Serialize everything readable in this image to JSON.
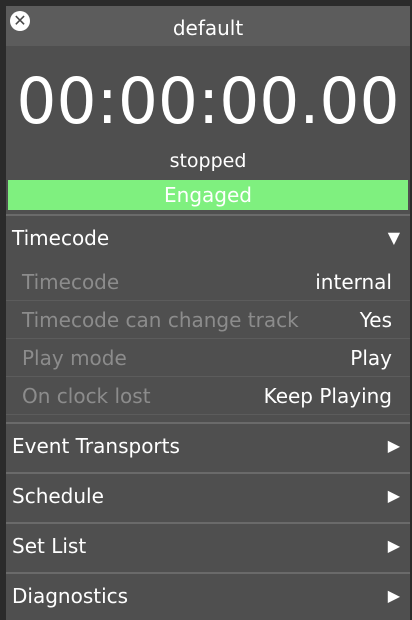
{
  "window": {
    "title": "default"
  },
  "clock": {
    "time": "00:00:00.00",
    "state": "stopped",
    "engaged_label": "Engaged"
  },
  "sections": {
    "timecode": {
      "label": "Timecode",
      "arrow": "▼"
    },
    "event_transports": {
      "label": "Event Transports",
      "arrow": "▶"
    },
    "schedule": {
      "label": "Schedule",
      "arrow": "▶"
    },
    "set_list": {
      "label": "Set List",
      "arrow": "▶"
    },
    "diagnostics": {
      "label": "Diagnostics",
      "arrow": "▶"
    }
  },
  "timecode_rows": [
    {
      "label": "Timecode",
      "value": "internal"
    },
    {
      "label": "Timecode can change track",
      "value": "Yes"
    },
    {
      "label": "Play mode",
      "value": "Play"
    },
    {
      "label": "On clock lost",
      "value": "Keep Playing"
    }
  ],
  "icons": {
    "close": "close-icon"
  },
  "colors": {
    "engaged": "#7ff07f",
    "panel": "#4f4f4f",
    "muted_label": "#8c8c8c"
  }
}
